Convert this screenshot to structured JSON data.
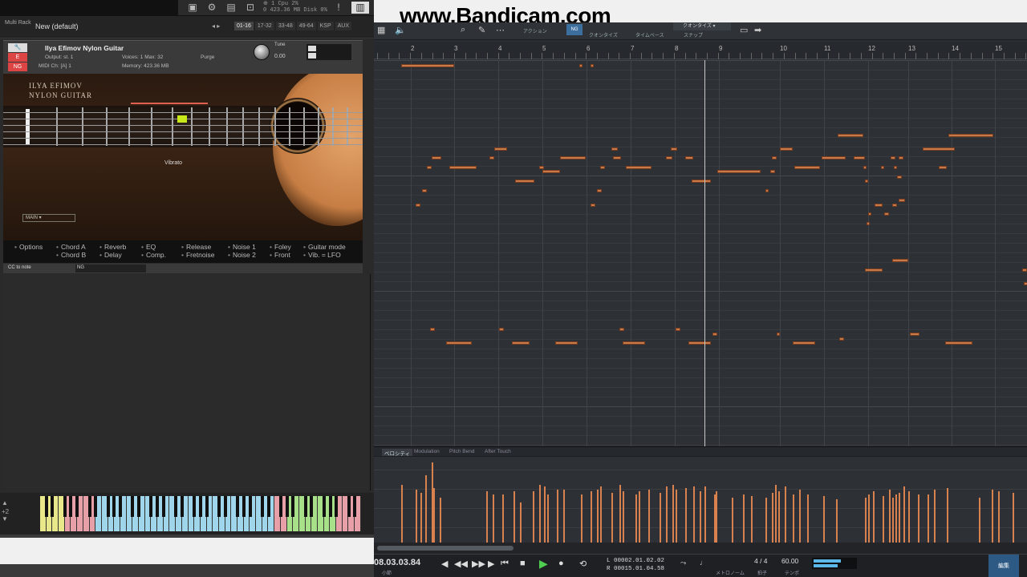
{
  "watermark": "www.Bandicam.com",
  "kontakt": {
    "toolbar_stats": {
      "line1": "⊕ 1   Cpu  2%",
      "line2": "0  423.36 MB  Disk 0%"
    },
    "multi_rack_label": "Multi Rack",
    "rack_name": "New (default)",
    "pages": [
      "01-16",
      "17-32",
      "33-48",
      "49-64",
      "KSP",
      "AUX"
    ],
    "instrument": {
      "name": "Ilya Efimov Nylon Guitar",
      "output_label": "Output:",
      "output_value": "st. 1",
      "voices_label": "Voices:",
      "voices_value": "1",
      "max_label": "Max:",
      "max_value": "32",
      "purge_label": "Purge",
      "midi_label": "MIDI Ch:",
      "midi_value": "[A] 1",
      "memory_label": "Memory:",
      "memory_value": "423.36 MB",
      "tune_label": "Tune",
      "tune_value": "0.00"
    },
    "panel": {
      "title_line1": "ILYA EFIMOV",
      "title_line2": "NYLON GUITAR",
      "articulation": "Vibrato",
      "main_select": "MAIN"
    },
    "tabs": [
      [
        "Options",
        ""
      ],
      [
        "Chord A",
        "Chord B"
      ],
      [
        "Reverb",
        "Delay"
      ],
      [
        "EQ",
        "Comp."
      ],
      [
        "Release",
        "Fretnoise"
      ],
      [
        "Noise 1",
        "Noise 2"
      ],
      [
        "Foley",
        "Front"
      ],
      [
        "Guitar mode",
        "Vib. = LFO"
      ]
    ],
    "cc_label": "CC to note",
    "ng_label": "NG",
    "octave_label": "+2"
  },
  "daw": {
    "toolbar": {
      "quantize_label": "クオンタイズ",
      "timebase_label": "タイムベース",
      "snap_label": "スナップ",
      "action_label": "アクション",
      "quantize_select": "クオンタイズ",
      "ng_badge": "NG"
    },
    "ruler_numbers": [
      "2",
      "3",
      "4",
      "5",
      "6",
      "7",
      "8",
      "9",
      "10",
      "11",
      "12",
      "13",
      "14",
      "15"
    ],
    "lanes": [
      "ベロシティ",
      "Modulation",
      "Pitch Bend",
      "After Touch"
    ],
    "transport": {
      "position": "08.03.03.84",
      "position_sub": "小節",
      "loop_start_label": "L",
      "loop_start": "00002.01.02.02",
      "loop_end_label": "R",
      "loop_end": "00015.01.04.58",
      "metronome_label": "メトロノーム",
      "timesig": "4 / 4",
      "timesig_label": "拍子",
      "tempo": "60.00",
      "tempo_label": "テンポ",
      "edit_button": "編集"
    }
  },
  "colors": {
    "note_fill": "#c87a4a",
    "velocity": "#d98250",
    "play": "#4fcf4f",
    "accent_blue": "#3c6e9e"
  }
}
